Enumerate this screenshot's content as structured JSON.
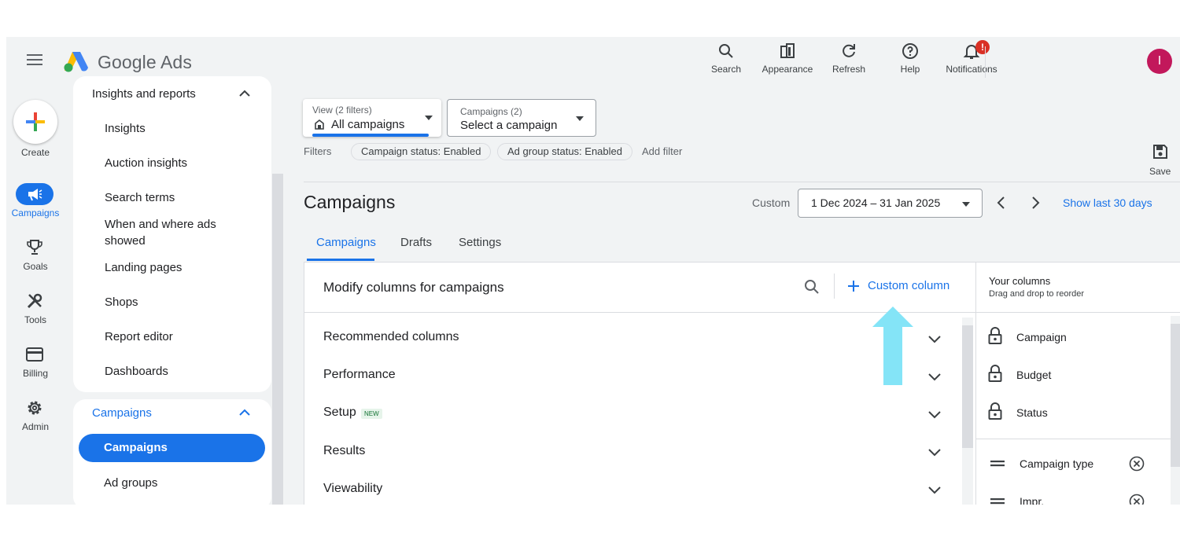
{
  "app": {
    "name": "Google Ads",
    "avatar_initial": "I"
  },
  "top_actions": [
    {
      "id": "search",
      "label": "Search"
    },
    {
      "id": "appearance",
      "label": "Appearance"
    },
    {
      "id": "refresh",
      "label": "Refresh"
    },
    {
      "id": "help",
      "label": "Help"
    },
    {
      "id": "notifications",
      "label": "Notifications",
      "badge": "!"
    }
  ],
  "rail": {
    "create": "Create",
    "campaigns": "Campaigns",
    "goals": "Goals",
    "tools": "Tools",
    "billing": "Billing",
    "admin": "Admin"
  },
  "nav": {
    "insights_header": "Insights and reports",
    "insights_items": [
      "Insights",
      "Auction insights",
      "Search terms",
      "When and where ads showed",
      "Landing pages",
      "Shops",
      "Report editor",
      "Dashboards"
    ],
    "campaigns_header": "Campaigns",
    "campaigns_items": [
      "Campaigns",
      "Ad groups"
    ]
  },
  "view": {
    "label": "View (2 filters)",
    "value": "All campaigns"
  },
  "campaign_select": {
    "label": "Campaigns (2)",
    "value": "Select a campaign"
  },
  "filters": {
    "label": "Filters",
    "chips": [
      "Campaign status: Enabled",
      "Ad group status: Enabled"
    ],
    "add": "Add filter",
    "save": "Save"
  },
  "page": {
    "title": "Campaigns",
    "date_mode": "Custom",
    "date_range": "1 Dec 2024 – 31 Jan 2025",
    "show_last": "Show last 30 days"
  },
  "tabs": [
    "Campaigns",
    "Drafts",
    "Settings"
  ],
  "modify": {
    "title": "Modify columns for campaigns",
    "custom_column": "Custom column",
    "sections": [
      "Recommended columns",
      "Performance",
      "Setup",
      "Results",
      "Viewability"
    ],
    "new_badge": "NEW"
  },
  "your_columns": {
    "title": "Your columns",
    "subtitle": "Drag and drop to reorder",
    "locked": [
      "Campaign",
      "Budget",
      "Status"
    ],
    "movable": [
      "Campaign type",
      "Impr."
    ]
  },
  "colors": {
    "accent": "#1a73e8",
    "arrow": "#84e4f7",
    "alert": "#d93025",
    "avatar": "#c2185b"
  }
}
